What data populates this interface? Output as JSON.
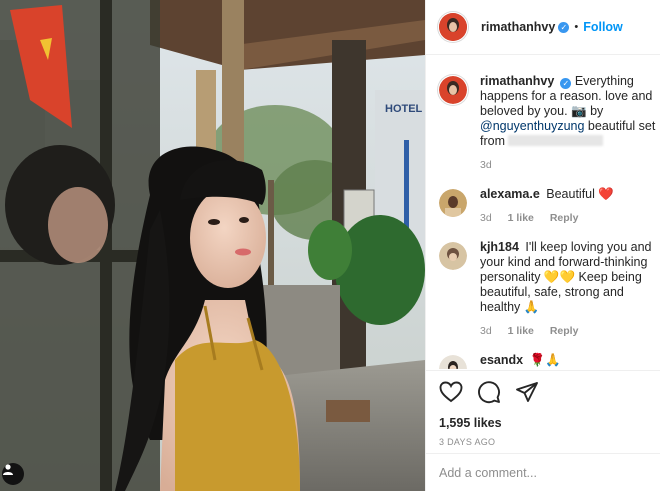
{
  "post": {
    "author": {
      "username": "rimathanhvy",
      "verified": true,
      "follow_label": "Follow",
      "separator": "•"
    },
    "caption": {
      "username": "rimathanhvy",
      "text_part1": "Everything happens for a reason. ",
      "text_part2": "love and beloved by you. 📷 by ",
      "mention": "@nguyenthuyzung",
      "text_part3": " beautiful set from",
      "time": "3d"
    },
    "comments": [
      {
        "username": "alexama.e",
        "text": "Beautiful ❤️",
        "time": "3d",
        "likes": "1 like",
        "reply_label": "Reply"
      },
      {
        "username": "kjh184",
        "text": "I'll keep loving you and your kind and forward-thinking personality 💛💛 Keep being beautiful, safe, strong and healthy 🙏",
        "time": "3d",
        "likes": "1 like",
        "reply_label": "Reply"
      },
      {
        "username": "esandx",
        "text": "🌹🙏"
      }
    ],
    "likes": "1,595 likes",
    "posted_ago": "3 DAYS AGO",
    "comment_placeholder": "Add a comment..."
  },
  "photo": {
    "sign_text": "HOTEL"
  },
  "icons": [
    "heart-icon",
    "comment-icon",
    "share-icon",
    "user-tag-icon",
    "verified-badge-icon"
  ],
  "colors": {
    "link_blue": "#0095f6",
    "secondary_text": "#8e8e8e",
    "verified_blue": "#3897f0",
    "dress_mustard": "#c89a2e"
  }
}
